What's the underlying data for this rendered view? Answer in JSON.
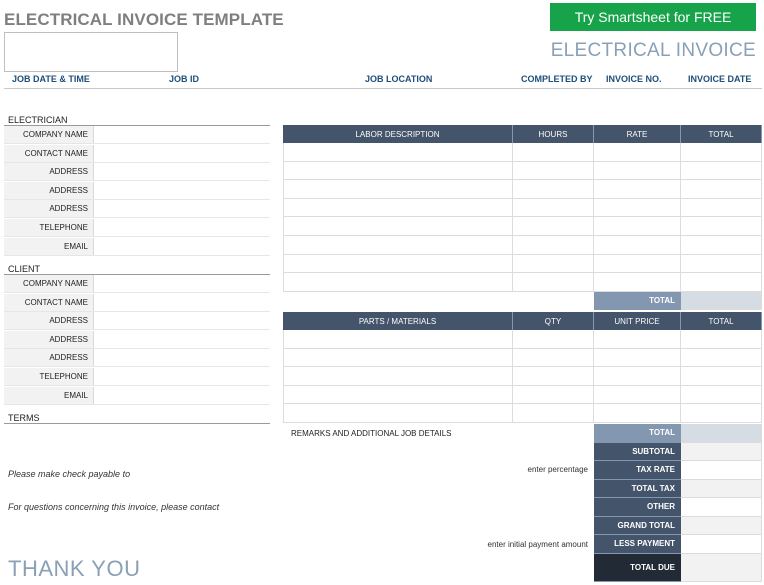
{
  "page": {
    "title": "ELECTRICAL INVOICE TEMPLATE",
    "cta_label": "Try Smartsheet for FREE",
    "invoice_title": "ELECTRICAL INVOICE",
    "thank_you": "THANK YOU"
  },
  "header_fields": [
    "JOB DATE & TIME",
    "JOB ID",
    "JOB LOCATION",
    "COMPLETED BY",
    "INVOICE NO.",
    "INVOICE DATE"
  ],
  "electrician": {
    "label": "ELECTRICIAN",
    "fields": [
      "COMPANY NAME",
      "CONTACT NAME",
      "ADDRESS",
      "ADDRESS",
      "ADDRESS",
      "TELEPHONE",
      "EMAIL"
    ]
  },
  "client": {
    "label": "CLIENT",
    "fields": [
      "COMPANY NAME",
      "CONTACT NAME",
      "ADDRESS",
      "ADDRESS",
      "ADDRESS",
      "TELEPHONE",
      "EMAIL"
    ]
  },
  "terms": {
    "label": "TERMS",
    "check_payable": "Please make check payable to",
    "questions": "For questions concerning this invoice, please contact"
  },
  "labor_table": {
    "headers": [
      "LABOR DESCRIPTION",
      "HOURS",
      "RATE",
      "TOTAL"
    ],
    "total_label": "TOTAL"
  },
  "parts_table": {
    "headers": [
      "PARTS / MATERIALS",
      "QTY",
      "UNIT PRICE",
      "TOTAL"
    ]
  },
  "summary": {
    "remarks_label": "REMARKS AND ADDITIONAL JOB DETAILS",
    "enter_percentage": "enter percentage",
    "enter_payment": "enter initial payment amount",
    "rows": [
      "TOTAL",
      "SUBTOTAL",
      "TAX RATE",
      "TOTAL TAX",
      "OTHER",
      "GRAND TOTAL",
      "LESS PAYMENT",
      "TOTAL DUE"
    ]
  },
  "colors": {
    "header_navy": "#44546a",
    "header_light": "#8497b0",
    "cta_green": "#17a34a",
    "accent_text": "#1f4e79"
  }
}
